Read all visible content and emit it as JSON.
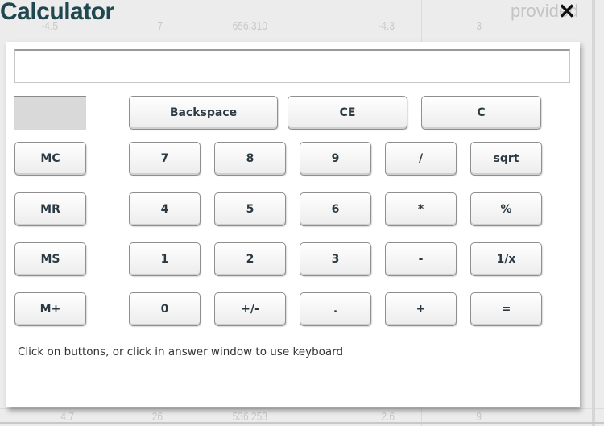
{
  "window": {
    "title": "Calculator",
    "close_label": "✕"
  },
  "background": {
    "row1": [
      "-4.5",
      "7",
      "656,310",
      "-4.3",
      "3"
    ],
    "row_bottom": [
      "4.7",
      "26",
      "536,253",
      "2.6",
      "9"
    ],
    "partial_text": "provided"
  },
  "display": {
    "value": ""
  },
  "top_row": [
    {
      "id": "backspace",
      "label": "Backspace"
    },
    {
      "id": "ce",
      "label": "CE"
    },
    {
      "id": "c",
      "label": "C"
    }
  ],
  "memory_buttons": [
    {
      "id": "mc",
      "label": "MC"
    },
    {
      "id": "mr",
      "label": "MR"
    },
    {
      "id": "ms",
      "label": "MS"
    },
    {
      "id": "m-plus",
      "label": "M+"
    }
  ],
  "keypad": [
    [
      {
        "id": "7",
        "label": "7"
      },
      {
        "id": "8",
        "label": "8"
      },
      {
        "id": "9",
        "label": "9"
      },
      {
        "id": "divide",
        "label": "/"
      },
      {
        "id": "sqrt",
        "label": "sqrt"
      }
    ],
    [
      {
        "id": "4",
        "label": "4"
      },
      {
        "id": "5",
        "label": "5"
      },
      {
        "id": "6",
        "label": "6"
      },
      {
        "id": "multiply",
        "label": "*"
      },
      {
        "id": "percent",
        "label": "%"
      }
    ],
    [
      {
        "id": "1",
        "label": "1"
      },
      {
        "id": "2",
        "label": "2"
      },
      {
        "id": "3",
        "label": "3"
      },
      {
        "id": "subtract",
        "label": "-"
      },
      {
        "id": "reciprocal",
        "label": "1/x"
      }
    ],
    [
      {
        "id": "0",
        "label": "0"
      },
      {
        "id": "plus-minus",
        "label": "+/-"
      },
      {
        "id": "decimal",
        "label": "."
      },
      {
        "id": "add",
        "label": "+"
      },
      {
        "id": "equals",
        "label": "="
      }
    ]
  ],
  "hint": "Click on buttons, or click in answer window to use keyboard"
}
